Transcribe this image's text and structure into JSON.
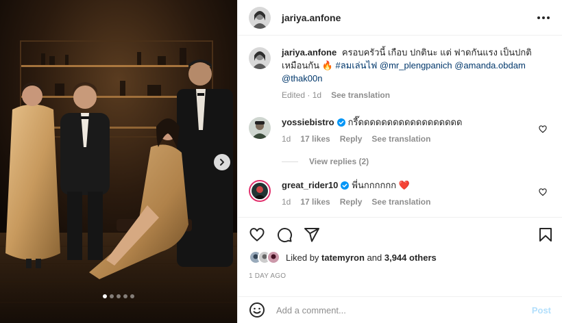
{
  "post": {
    "author": "jariya.anfone",
    "more_icon": "more-horizontal-icon",
    "carousel": {
      "slides": 5,
      "active_index": 0,
      "next_icon": "chevron-right-icon"
    }
  },
  "caption": {
    "username": "jariya.anfone",
    "text": "ครอบครัวนี้ เกือบ ปกตินะ แต่ ฟาดกันแรง เป็นปกติเหมือนกัน 🔥",
    "hashtag": "#ลมเล่นไฟ",
    "mentions": [
      "@mr_plengpanich",
      "@amanda.obdam",
      "@thak00n"
    ],
    "edited": "Edited",
    "time": "1d",
    "see_translation": "See translation"
  },
  "comments": [
    {
      "username": "yossiebistro",
      "verified": true,
      "text": "กรี๊ดดดดดดดดดดดดดดดดดด",
      "time": "1d",
      "likes": "17 likes",
      "reply": "Reply",
      "see_translation": "See translation",
      "view_replies": "View replies (2)"
    },
    {
      "username": "great_rider10",
      "verified": true,
      "text": "พี่นกกกกกก ❤️",
      "time": "1d",
      "likes": "17 likes",
      "reply": "Reply",
      "see_translation": "See translation"
    }
  ],
  "actions": {
    "like_icon": "heart-icon",
    "comment_icon": "comment-icon",
    "share_icon": "share-icon",
    "save_icon": "bookmark-icon"
  },
  "likes": {
    "prefix": "Liked by",
    "user": "tatemyron",
    "connector": "and",
    "others": "3,944 others"
  },
  "date": "1 DAY AGO",
  "add_comment": {
    "emoji_icon": "emoji-icon",
    "placeholder": "Add a comment...",
    "post_label": "Post"
  },
  "colors": {
    "link": "#00376b",
    "verified": "#0095f6",
    "muted": "#8e8e8e",
    "post_disabled": "#b2dffc"
  }
}
